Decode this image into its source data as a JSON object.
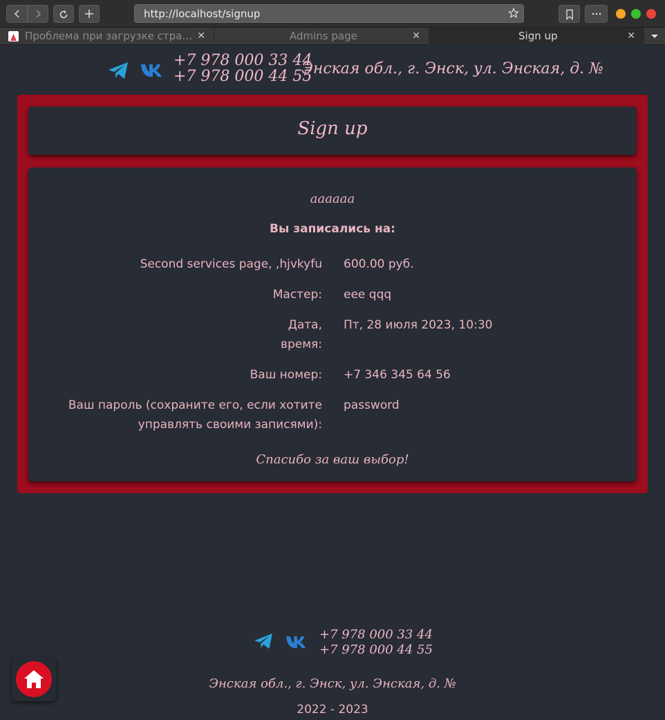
{
  "browser": {
    "url": "http://localhost/signup",
    "tabs": [
      {
        "label": "Проблема при загрузке стра…",
        "active": false
      },
      {
        "label": "Admins page",
        "active": false
      },
      {
        "label": "Sign up",
        "active": true
      }
    ],
    "tab_close_glyph": "✕",
    "traffic_colors": [
      "#f5a623",
      "#3cc02f",
      "#e8453c"
    ]
  },
  "header": {
    "phone_1": "+7 978 000 33 44",
    "phone_2": "+7 978 000 44 55",
    "address": "Энская обл., г. Энск, ул. Энская, д. №",
    "icons": [
      "telegram-icon",
      "vk-icon"
    ]
  },
  "page": {
    "title": "Sign up",
    "service_name": "аааааа",
    "subtitle": "Вы записались на:",
    "rows": [
      {
        "label": "Second services page, ,hjvkyfu",
        "value": "600.00 руб."
      },
      {
        "label": "Мастер:",
        "value": "eee qqq"
      },
      {
        "label": "Дата, время:",
        "value": "Пт, 28 июля 2023, 10:30"
      },
      {
        "label": "Ваш номер:",
        "value": "+7 346 345 64 56"
      },
      {
        "label": "Ваш пароль (сохраните его, если хотите управлять своими записями):",
        "value": "password"
      }
    ],
    "thanks": "Спасибо за ваш выбор!"
  },
  "footer": {
    "phone_1": "+7 978 000 33 44",
    "phone_2": "+7 978 000 44 55",
    "address": "Энская обл., г. Энск, ул. Энская, д. №",
    "years": "2022 - 2023"
  },
  "colors": {
    "background": "#282c34",
    "frame": "#9c0d1e",
    "text": "#e8b4c0",
    "telegram": "#2aa1da",
    "vk": "#2a7fd4",
    "home": "#d91023"
  }
}
